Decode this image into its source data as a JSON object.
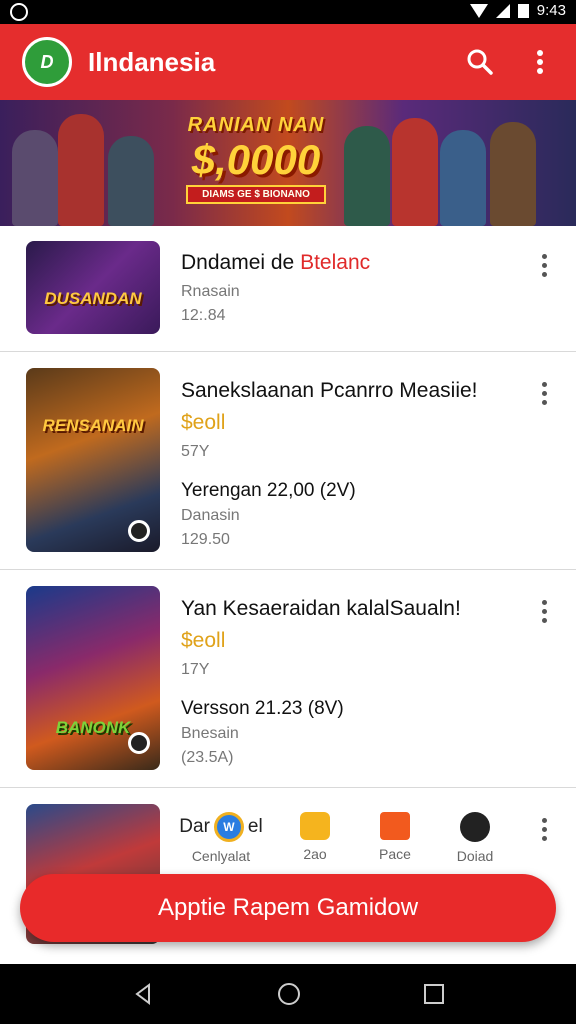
{
  "status": {
    "time": "9:43"
  },
  "appbar": {
    "title": "Ilndanesia",
    "logo_text": "D"
  },
  "banner": {
    "line1": "RANIAN NAN",
    "line2": "$,0000",
    "line3": "DIAMS GE $ BIONANO"
  },
  "items": [
    {
      "title": "Dndamei de ",
      "title_red": "Btelanc",
      "sub1": "Rnasain",
      "sub2": "12:.84",
      "thumb_label": "DUSANDAN"
    },
    {
      "title": "Sanekslaanan Pcanrro Measiie!",
      "gold": "$eoll",
      "rating": "57Y",
      "version": "Yerengan 22,00 (2V)",
      "sub1": "Danasin",
      "sub2": "129.50",
      "thumb_label": "RENSANAIN"
    },
    {
      "title": "Yan Kesaeraidan kalalSaualn!",
      "gold": "$eoll",
      "rating": "17Y",
      "version": "Versson 21.23 (8V)",
      "sub1": "Bnesain",
      "sub2": "(23.5A)",
      "thumb_label": "BANONK"
    },
    {
      "title_short": "Dar",
      "title_tail": "el",
      "icons": [
        {
          "label": "Cenlyalat"
        },
        {
          "label": "2ao"
        },
        {
          "label": "Pace"
        },
        {
          "label": "Doiad"
        }
      ]
    }
  ],
  "fab": {
    "label": "Apptie Rapem Gamidow"
  },
  "colors": {
    "primary": "#e52d2d",
    "gold": "#e0a21a"
  }
}
